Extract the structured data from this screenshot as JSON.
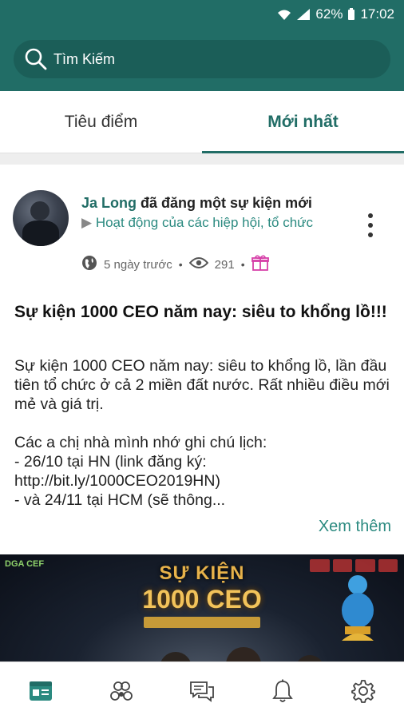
{
  "status_bar": {
    "battery": "62%",
    "time": "17:02"
  },
  "search": {
    "placeholder": "Tìm Kiếm"
  },
  "tabs": [
    {
      "label": "Tiêu điểm",
      "active": false
    },
    {
      "label": "Mới nhất",
      "active": true
    }
  ],
  "post": {
    "author": "Ja Long",
    "action": "đã đăng một sự kiện mới",
    "category": "Hoạt động của các hiệp hội, tổ chức",
    "time": "5 ngày trước",
    "views": "291",
    "title": "Sự kiện 1000 CEO năm nay: siêu to khổng lồ!!!",
    "body": "Sự kiện 1000 CEO năm nay: siêu to khổng lồ, lần đầu tiên tổ chức ở cả 2 miền đất nước. Rất nhiều điều mới mẻ và giá trị.\n\nCác a chị nhà mình nhớ ghi chú lịch:\n- 26/10 tại HN (link đăng ký: http://bit.ly/1000CEO2019HN)\n- và 24/11 tại HCM (sẽ thông...",
    "see_more": "Xem thêm"
  },
  "banner": {
    "line1": "SỰ KIỆN",
    "line2": "1000 CEO",
    "logo_left": "DGA CEF"
  },
  "bottom_nav": [
    {
      "icon": "newsfeed-icon",
      "active": true
    },
    {
      "icon": "groups-icon",
      "active": false
    },
    {
      "icon": "chat-icon",
      "active": false
    },
    {
      "icon": "bell-icon",
      "active": false
    },
    {
      "icon": "gear-icon",
      "active": false
    }
  ],
  "colors": {
    "primary": "#216d66",
    "accent": "#2b8a80"
  }
}
